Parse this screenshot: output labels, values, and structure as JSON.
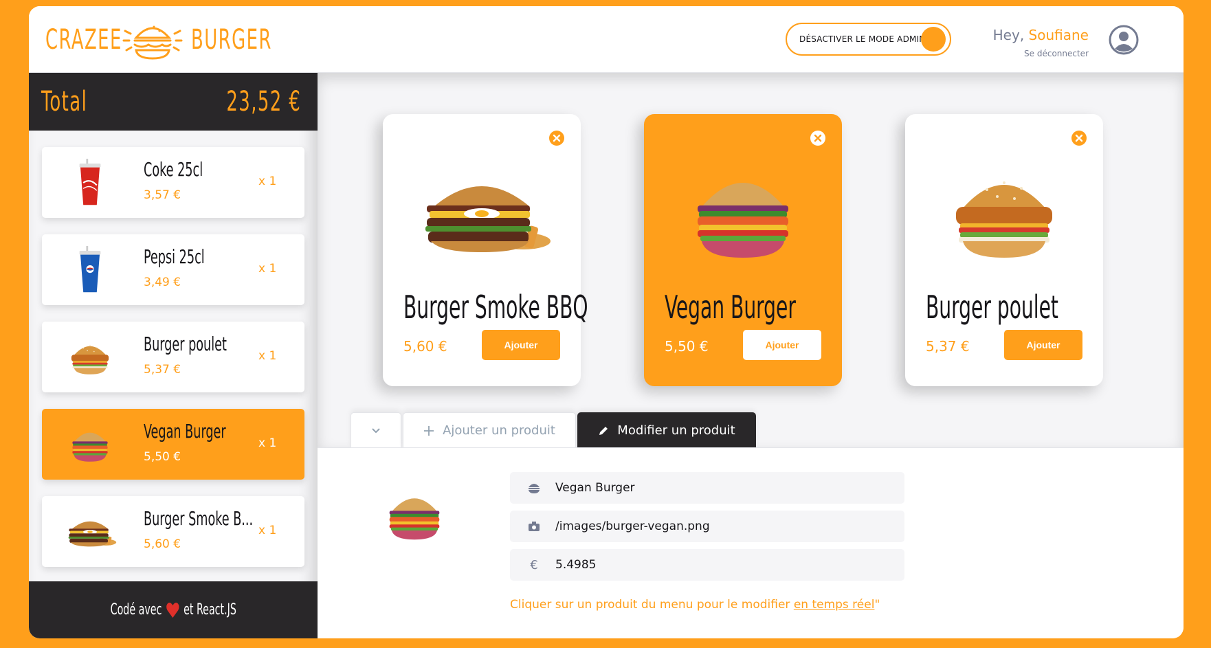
{
  "header": {
    "logo_left": "CRAZEE",
    "logo_right": "BURGER",
    "admin_toggle_label": "DÉSACTIVER LE MODE ADMIN",
    "greeting": "Hey, ",
    "user_name": "Soufiane",
    "logout_label": "Se déconnecter"
  },
  "basket": {
    "total_label": "Total",
    "total_value": "23,52 €",
    "items": [
      {
        "title": "Coke 25cl",
        "price": "3,57 €",
        "qty": "x 1",
        "image": "coke-cup"
      },
      {
        "title": "Pepsi 25cl",
        "price": "3,49 €",
        "qty": "x 1",
        "image": "pepsi-cup"
      },
      {
        "title": "Burger poulet",
        "price": "5,37 €",
        "qty": "x 1",
        "image": "chicken-burger"
      },
      {
        "title": "Vegan Burger",
        "price": "5,50 €",
        "qty": "x 1",
        "image": "vegan-burger"
      },
      {
        "title": "Burger Smoke B...",
        "price": "5,60 €",
        "qty": "x 1",
        "image": "bbq-burger"
      }
    ],
    "footer_prefix": "Codé avec",
    "footer_suffix": "et React.JS"
  },
  "menu": {
    "products": [
      {
        "name": "Burger Smoke BBQ",
        "price": "5,60 €",
        "add_label": "Ajouter",
        "image": "bbq-burger",
        "selected": false
      },
      {
        "name": "Vegan Burger",
        "price": "5,50 €",
        "add_label": "Ajouter",
        "image": "vegan-burger",
        "selected": true
      },
      {
        "name": "Burger poulet",
        "price": "5,37 €",
        "add_label": "Ajouter",
        "image": "chicken-burger",
        "selected": false
      }
    ]
  },
  "admin": {
    "tabs": {
      "add_label": "Ajouter un produit",
      "edit_label": "Modifier un produit"
    },
    "form": {
      "name_value": "Vegan Burger",
      "image_value": "/images/burger-vegan.png",
      "price_value": "5.4985"
    },
    "hint_prefix": "Cliquer sur un produit du menu pour le modifier ",
    "hint_link": "en temps réel",
    "hint_suffix": "\""
  },
  "colors": {
    "primary": "#ff9f1b",
    "dark": "#292729",
    "background": "#f5f5f7"
  }
}
